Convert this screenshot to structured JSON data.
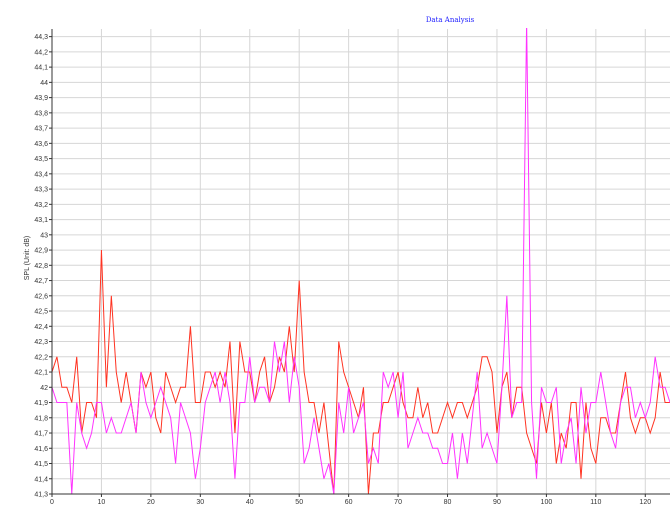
{
  "chart_data": {
    "type": "line",
    "title": "Data Analysis",
    "ylabel": "SPL  (Unit: dB)",
    "xlabel": "",
    "xlim": [
      0,
      125
    ],
    "ylim": [
      41.3,
      44.35
    ],
    "grid": true,
    "yticks": [
      "41,3",
      "41,4",
      "41,5",
      "41,6",
      "41,7",
      "41,8",
      "41,9",
      "42",
      "42,1",
      "42,2",
      "42,3",
      "42,4",
      "42,5",
      "42,6",
      "42,7",
      "42,8",
      "42,9",
      "43",
      "43,1",
      "43,2",
      "43,3",
      "43,4",
      "43,5",
      "43,6",
      "43,7",
      "43,8",
      "43,9",
      "44",
      "44,1",
      "44,2",
      "44,3"
    ],
    "xticks": [
      "0",
      "10",
      "20",
      "30",
      "40",
      "50",
      "60",
      "70",
      "80",
      "90",
      "100",
      "110",
      "120"
    ],
    "colors": {
      "series1": "#ff3322",
      "series2": "#ff33ff",
      "grid": "#d6d6d6",
      "axis": "#333333",
      "title": "#1a1aff"
    },
    "series": [
      {
        "x": [
          0,
          1,
          2,
          3,
          4,
          5,
          6,
          7,
          8,
          9,
          10,
          11,
          12,
          13,
          14,
          15,
          16,
          17,
          18,
          19,
          20,
          21,
          22,
          23,
          24,
          25,
          26,
          27,
          28,
          29,
          30,
          31,
          32,
          33,
          34,
          35,
          36,
          37,
          38,
          39,
          40,
          41,
          42,
          43,
          44,
          45,
          46,
          47,
          48,
          49,
          50,
          51,
          52,
          53,
          54,
          55,
          56,
          57,
          58,
          59,
          60,
          61,
          62,
          63,
          64,
          65,
          66,
          67,
          68,
          69,
          70,
          71,
          72,
          73,
          74,
          75,
          76,
          77,
          78,
          79,
          80,
          81,
          82,
          83,
          84,
          85,
          86,
          87,
          88,
          89,
          90,
          91,
          92,
          93,
          94,
          95,
          96,
          97,
          98,
          99,
          100,
          101,
          102,
          103,
          104,
          105,
          106,
          107,
          108,
          109,
          110,
          111,
          112,
          113,
          114,
          115,
          116,
          117,
          118,
          119,
          120,
          121,
          122,
          123,
          124,
          125
        ],
        "values": [
          42.1,
          42.2,
          42.0,
          42.0,
          41.9,
          42.2,
          41.7,
          41.9,
          41.9,
          41.8,
          42.9,
          42.0,
          42.6,
          42.1,
          41.9,
          42.1,
          41.9,
          41.7,
          42.1,
          42.0,
          42.1,
          41.8,
          41.7,
          42.1,
          42.0,
          41.9,
          42.0,
          42.0,
          42.4,
          41.9,
          41.9,
          42.1,
          42.1,
          42.0,
          42.1,
          42.0,
          42.3,
          41.7,
          42.3,
          42.1,
          42.1,
          41.9,
          42.1,
          42.2,
          41.9,
          42.0,
          42.2,
          42.1,
          42.4,
          42.1,
          42.7,
          42.1,
          41.9,
          41.9,
          41.7,
          41.9,
          41.6,
          41.3,
          42.3,
          42.1,
          42.0,
          41.9,
          41.8,
          42.0,
          41.3,
          41.7,
          41.7,
          41.9,
          41.9,
          42.0,
          42.1,
          41.9,
          41.8,
          41.8,
          42.0,
          41.8,
          41.9,
          41.7,
          41.7,
          41.8,
          41.9,
          41.8,
          41.9,
          41.9,
          41.8,
          41.9,
          42.0,
          42.2,
          42.2,
          42.1,
          41.7,
          42.0,
          42.1,
          41.8,
          42.0,
          42.0,
          41.7,
          41.6,
          41.5,
          41.9,
          41.7,
          41.9,
          41.5,
          41.7,
          41.6,
          41.9,
          41.9,
          41.4,
          41.9,
          41.6,
          41.5,
          41.8,
          41.8,
          41.7,
          41.7,
          41.9,
          42.1,
          41.8,
          41.7,
          41.8,
          41.8,
          41.7,
          41.8,
          42.1,
          41.9,
          41.9
        ],
        "name": ""
      },
      {
        "x": [
          0,
          1,
          2,
          3,
          4,
          5,
          6,
          7,
          8,
          9,
          10,
          11,
          12,
          13,
          14,
          15,
          16,
          17,
          18,
          19,
          20,
          21,
          22,
          23,
          24,
          25,
          26,
          27,
          28,
          29,
          30,
          31,
          32,
          33,
          34,
          35,
          36,
          37,
          38,
          39,
          40,
          41,
          42,
          43,
          44,
          45,
          46,
          47,
          48,
          49,
          50,
          51,
          52,
          53,
          54,
          55,
          56,
          57,
          58,
          59,
          60,
          61,
          62,
          63,
          64,
          65,
          66,
          67,
          68,
          69,
          70,
          71,
          72,
          73,
          74,
          75,
          76,
          77,
          78,
          79,
          80,
          81,
          82,
          83,
          84,
          85,
          86,
          87,
          88,
          89,
          90,
          91,
          92,
          93,
          94,
          95,
          96,
          97,
          98,
          99,
          100,
          101,
          102,
          103,
          104,
          105,
          106,
          107,
          108,
          109,
          110,
          111,
          112,
          113,
          114,
          115,
          116,
          117,
          118,
          119,
          120,
          121,
          122,
          123,
          124,
          125
        ],
        "values": [
          42.0,
          41.9,
          41.9,
          41.9,
          41.3,
          41.9,
          41.7,
          41.6,
          41.7,
          41.9,
          41.9,
          41.7,
          41.8,
          41.7,
          41.7,
          41.8,
          41.9,
          41.7,
          42.1,
          41.9,
          41.8,
          41.9,
          42.0,
          41.9,
          41.8,
          41.5,
          41.9,
          41.8,
          41.7,
          41.4,
          41.6,
          41.9,
          42.0,
          42.1,
          41.9,
          42.1,
          41.9,
          41.4,
          41.9,
          41.9,
          42.2,
          41.9,
          42.0,
          42.0,
          41.9,
          42.3,
          42.1,
          42.3,
          41.9,
          42.2,
          42.0,
          41.5,
          41.6,
          41.8,
          41.6,
          41.4,
          41.5,
          41.3,
          41.9,
          41.7,
          42.0,
          41.7,
          41.8,
          41.9,
          41.5,
          41.6,
          41.5,
          42.1,
          42.0,
          42.1,
          41.8,
          42.1,
          41.6,
          41.7,
          41.8,
          41.7,
          41.7,
          41.6,
          41.6,
          41.5,
          41.5,
          41.7,
          41.4,
          41.7,
          41.5,
          41.8,
          42.1,
          41.6,
          41.7,
          41.6,
          41.5,
          42.0,
          42.6,
          41.8,
          41.9,
          41.9,
          44.4,
          41.9,
          41.4,
          42.0,
          41.9,
          41.9,
          42.0,
          41.5,
          41.7,
          41.8,
          41.5,
          42.0,
          41.7,
          41.9,
          41.9,
          42.1,
          41.9,
          41.7,
          41.6,
          41.9,
          42.0,
          42.0,
          41.8,
          41.9,
          41.8,
          41.9,
          42.2,
          42.0,
          42.0,
          41.9
        ]
      }
    ]
  }
}
